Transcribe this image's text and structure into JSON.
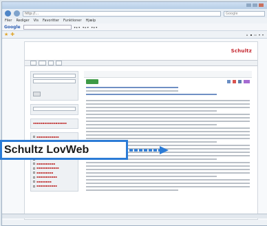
{
  "callout": {
    "label": "Schultz LovWeb"
  },
  "browser": {
    "url": "http://...",
    "search_placeholder": "Google",
    "menus": [
      "Filer",
      "Rediger",
      "Vis",
      "Favoritter",
      "Funktioner",
      "Hjælp"
    ],
    "google_label": "Google"
  },
  "site": {
    "logo": "Schultz"
  },
  "colors": {
    "callout_border": "#2b7bd6",
    "logo": "#c4262e",
    "links": "#c23b3b",
    "button": "#3e9a46"
  }
}
